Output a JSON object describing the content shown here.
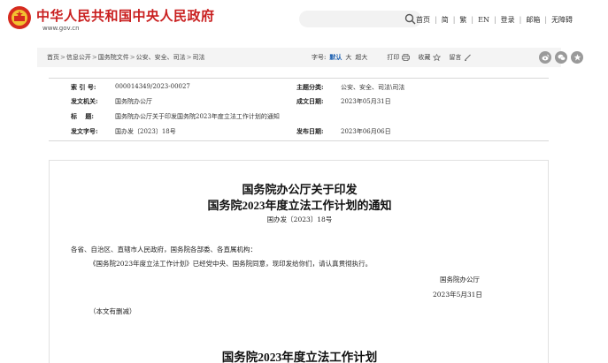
{
  "header": {
    "site_title": "中华人民共和国中央人民政府",
    "site_url": "www.gov.cn",
    "search": {
      "placeholder": "",
      "icon": "search-icon"
    },
    "nav": [
      "首页",
      "简",
      "繁",
      "EN",
      "登录",
      "邮箱",
      "无障碍"
    ],
    "brand_color": "#c91f1f"
  },
  "breadcrumb": [
    "首页",
    "信息公开",
    "国务院文件",
    "公安、安全、司法",
    "司法"
  ],
  "toolbar": {
    "font_label": "字号:",
    "font_sizes": [
      "默认",
      "大",
      "超大"
    ],
    "print": "打印",
    "favorite": "收藏",
    "comment": "留言",
    "share_icons": [
      "weibo-icon",
      "wechat-icon",
      "qzone-icon"
    ]
  },
  "meta": {
    "index_label": "索 引 号:",
    "index_value": "000014349/2023-00027",
    "topic_label": "主题分类:",
    "topic_value": "公安、安全、司法\\司法",
    "issuer_label": "发文机关:",
    "issuer_value": "国务院办公厅",
    "created_label": "成文日期:",
    "created_value": "2023年05月31日",
    "title_label": "标　 题:",
    "title_value": "国务院办公厅关于印发国务院2023年度立法工作计划的通知",
    "docnum_label": "发文字号:",
    "docnum_value": "国办发〔2023〕18号",
    "published_label": "发布日期:",
    "published_value": "2023年06月06日"
  },
  "article": {
    "title_line1": "国务院办公厅关于印发",
    "title_line2": "国务院2023年度立法工作计划的通知",
    "doc_number": "国办发〔2023〕18号",
    "salutation": "各省、自治区、直辖市人民政府，国务院各部委、各直属机构：",
    "paragraph": "《国务院2023年度立法工作计划》已经党中央、国务院同意，现印发给你们，请认真贯彻执行。",
    "signature": "国务院办公厅",
    "date": "2023年5月31日",
    "note": "（本文有删减）",
    "plan_title": "国务院2023年度立法工作计划"
  }
}
